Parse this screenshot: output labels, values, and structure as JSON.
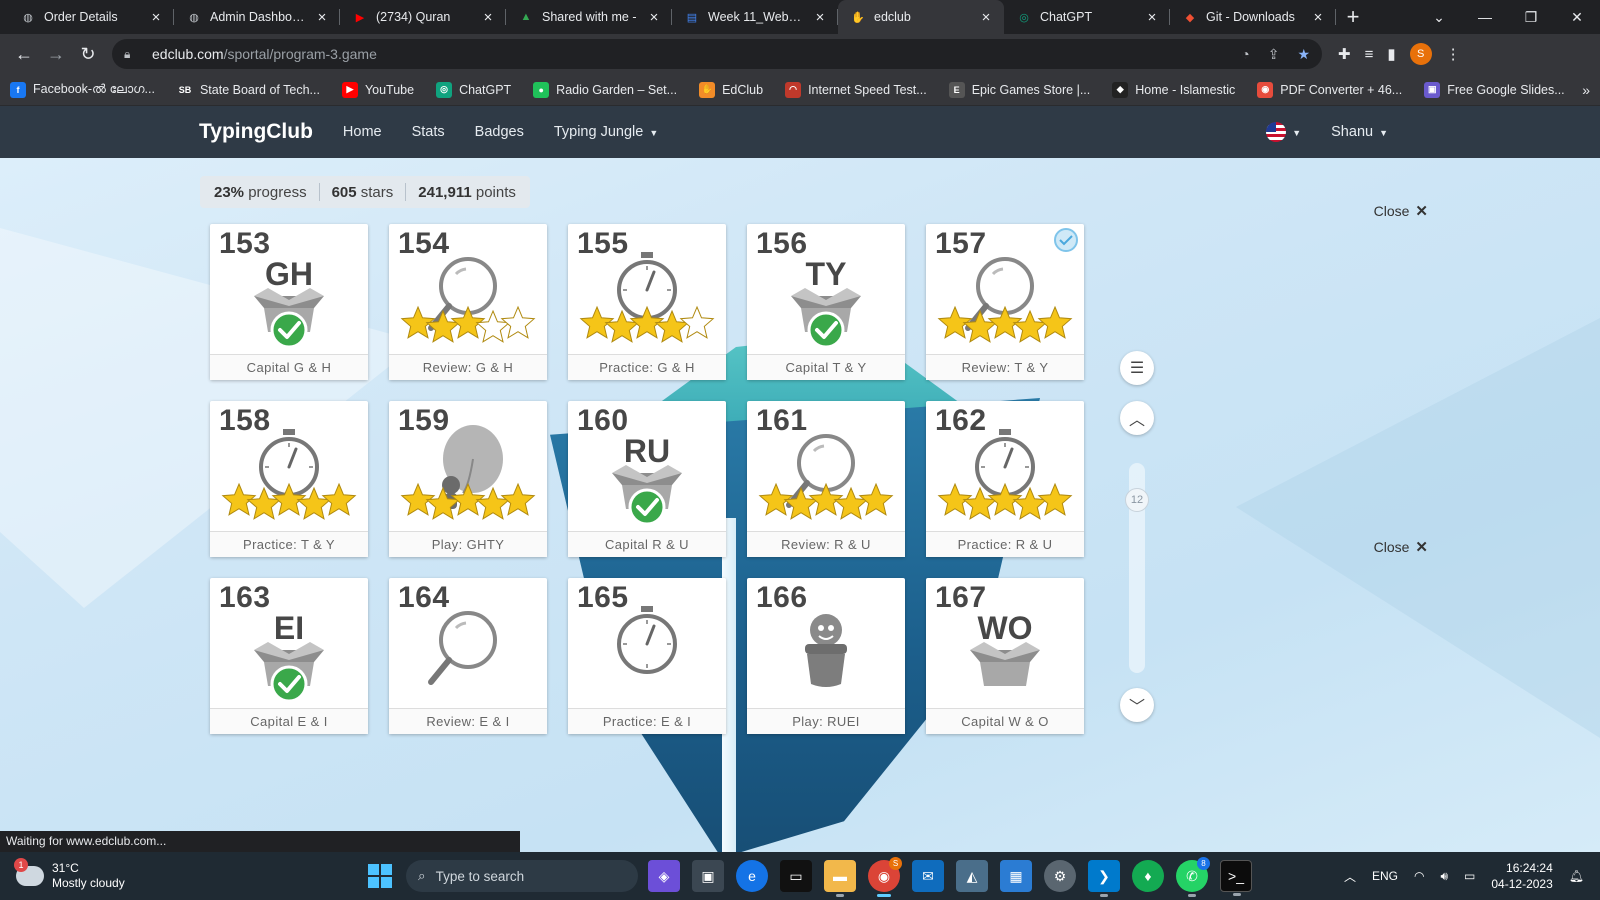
{
  "browser": {
    "tabs": [
      {
        "title": "Order Details",
        "icon": "globe-icon",
        "active": false
      },
      {
        "title": "Admin Dashboard",
        "icon": "globe-icon",
        "active": false
      },
      {
        "title": "(2734) Quran",
        "icon": "youtube-icon",
        "active": false
      },
      {
        "title": "Shared with me -",
        "icon": "drive-icon",
        "active": false
      },
      {
        "title": "Week 11_Web De",
        "icon": "docs-icon",
        "active": false
      },
      {
        "title": "edclub",
        "icon": "edclub-icon",
        "active": true
      },
      {
        "title": "ChatGPT",
        "icon": "chatgpt-icon",
        "active": false
      },
      {
        "title": "Git - Downloads",
        "icon": "git-icon",
        "active": false
      }
    ],
    "url_host": "edclub.com",
    "url_path": "/sportal/program-3.game",
    "profile_initial": "S",
    "bookmarks": [
      {
        "label": "Facebook-ൽ ലോഗ...",
        "color": "#1877f2",
        "glyph": "f"
      },
      {
        "label": "State Board of Tech...",
        "color": "#35363a",
        "glyph": "SB"
      },
      {
        "label": "YouTube",
        "color": "#ff0000",
        "glyph": "▶"
      },
      {
        "label": "ChatGPT",
        "color": "#10a37f",
        "glyph": "◎"
      },
      {
        "label": "Radio Garden – Set...",
        "color": "#20c25a",
        "glyph": "●"
      },
      {
        "label": "EdClub",
        "color": "#f28c28",
        "glyph": "✋"
      },
      {
        "label": "Internet Speed Test...",
        "color": "#c0392b",
        "glyph": "◠"
      },
      {
        "label": "Epic Games Store |...",
        "color": "#555",
        "glyph": "E"
      },
      {
        "label": "Home - Islamestic",
        "color": "#222",
        "glyph": "◆"
      },
      {
        "label": "PDF Converter + 46...",
        "color": "#e74c3c",
        "glyph": "◉"
      },
      {
        "label": "Free Google Slides...",
        "color": "#6a5acd",
        "glyph": "▣"
      }
    ],
    "status_text": "Waiting for www.edclub.com..."
  },
  "site": {
    "logo": "TypingClub",
    "nav": [
      "Home",
      "Stats",
      "Badges",
      "Typing Jungle"
    ],
    "user": "Shanu"
  },
  "progress": {
    "percent": "23%",
    "percent_label": "progress",
    "stars": "605",
    "stars_label": "stars",
    "points": "241,911",
    "points_label": "points"
  },
  "lessons": [
    {
      "num": "153",
      "type": "new",
      "keys": "GH",
      "label": "Capital G & H",
      "done": true,
      "stars": 0
    },
    {
      "num": "154",
      "type": "review",
      "keys": "",
      "label": "Review: G & H",
      "done": true,
      "stars": 3
    },
    {
      "num": "155",
      "type": "practice",
      "keys": "",
      "label": "Practice: G & H",
      "done": true,
      "stars": 4
    },
    {
      "num": "156",
      "type": "new",
      "keys": "TY",
      "label": "Capital T & Y",
      "done": true,
      "stars": 0
    },
    {
      "num": "157",
      "type": "review",
      "keys": "",
      "label": "Review: T & Y",
      "done": true,
      "stars": 5,
      "medal": true
    },
    {
      "num": "158",
      "type": "practice",
      "keys": "",
      "label": "Practice: T & Y",
      "done": true,
      "stars": 5
    },
    {
      "num": "159",
      "type": "play",
      "keys": "",
      "label": "Play: GHTY",
      "done": true,
      "stars": 5
    },
    {
      "num": "160",
      "type": "new",
      "keys": "RU",
      "label": "Capital R & U",
      "done": true,
      "stars": 0
    },
    {
      "num": "161",
      "type": "review",
      "keys": "",
      "label": "Review: R & U",
      "done": true,
      "stars": 5
    },
    {
      "num": "162",
      "type": "practice",
      "keys": "",
      "label": "Practice: R & U",
      "done": true,
      "stars": 5
    },
    {
      "num": "163",
      "type": "new",
      "keys": "EI",
      "label": "Capital E & I",
      "done": true,
      "stars": 0
    },
    {
      "num": "164",
      "type": "review",
      "keys": "",
      "label": "Review: E & I",
      "done": false,
      "stars": 0
    },
    {
      "num": "165",
      "type": "practice",
      "keys": "",
      "label": "Practice: E & I",
      "done": false,
      "stars": 0
    },
    {
      "num": "166",
      "type": "play2",
      "keys": "",
      "label": "Play: RUEI",
      "done": false,
      "stars": 0
    },
    {
      "num": "167",
      "type": "new",
      "keys": "WO",
      "label": "Capital W & O",
      "done": false,
      "stars": 0
    }
  ],
  "controls": {
    "close_label": "Close",
    "page_number": "12"
  },
  "taskbar": {
    "weather_temp": "31°C",
    "weather_desc": "Mostly cloudy",
    "weather_badge": "1",
    "search_placeholder": "Type to search",
    "language": "ENG",
    "time": "16:24:24",
    "date": "04-12-2023"
  },
  "colors": {
    "header_bg": "#2f3a46",
    "star_gold": "#f5c518",
    "check_green": "#3aa84a"
  }
}
